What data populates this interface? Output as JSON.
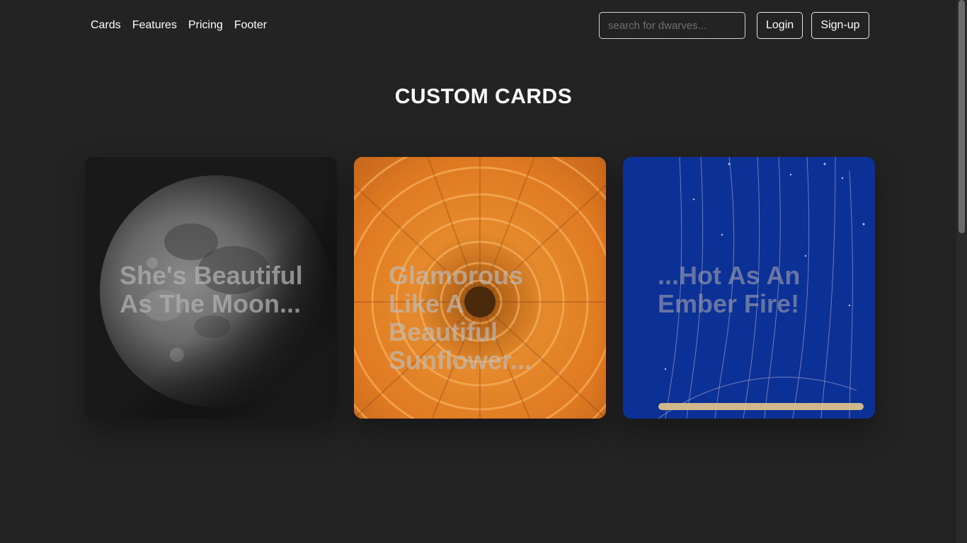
{
  "nav": {
    "links": [
      {
        "label": "Cards"
      },
      {
        "label": "Features"
      },
      {
        "label": "Pricing"
      },
      {
        "label": "Footer"
      }
    ],
    "search_placeholder": "search for dwarves...",
    "search_value": "",
    "login_label": "Login",
    "signup_label": "Sign-up"
  },
  "main": {
    "title": "CUSTOM CARDS",
    "cards": [
      {
        "caption": "She's Beautiful As The Moon...",
        "image": "moon"
      },
      {
        "caption": "Glamorous Like A Beautiful Sunflower...",
        "image": "orange-flower"
      },
      {
        "caption": "...Hot As An Ember Fire!",
        "image": "jellyfish"
      }
    ]
  },
  "colors": {
    "background": "#232323",
    "text": "#ffffff",
    "card_moon_bg": "#191919",
    "card_flower_bg": "#e07a22",
    "card_jelly_bg": "#0c3196"
  }
}
